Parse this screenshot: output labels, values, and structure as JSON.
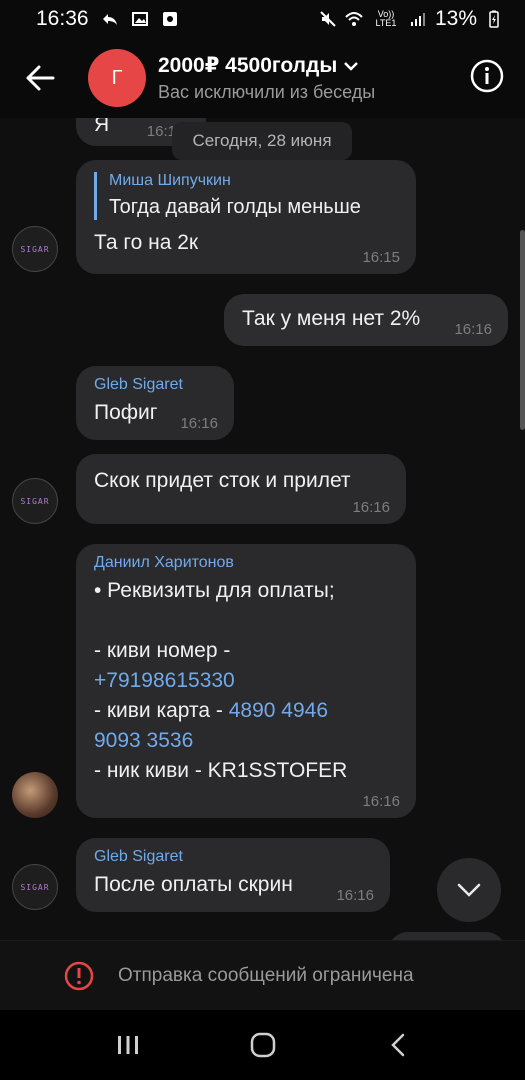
{
  "status": {
    "time": "16:36",
    "lte": "Vo)) LTE1",
    "battery": "13%"
  },
  "header": {
    "avatar_letter": "Г",
    "title": "2000₽ 4500голды",
    "subtitle": "Вас исключили из беседы"
  },
  "chat": {
    "date_chip": "Сегодня, 28 июня",
    "partial_top": {
      "text": "Я",
      "time": "16:1"
    },
    "messages": [
      {
        "reply_author": "Миша Шипучкин",
        "reply_text": "Тогда давай голды меньше",
        "text": "Та го на 2к",
        "time": "16:15"
      },
      {
        "text": "Так у меня нет 2%",
        "time": "16:16"
      },
      {
        "sender": "Gleb Sigaret",
        "text": "Пофиг",
        "time": "16:16"
      },
      {
        "text": "Скок придет сток и прилет",
        "time": "16:16"
      },
      {
        "sender": "Даниил Харитонов",
        "lines": [
          "• Реквизиты для оплаты;",
          "",
          "- киви номер -"
        ],
        "phone": "+79198615330",
        "card_prefix": "- киви карта - ",
        "card_part1": "4890 4946",
        "card_part2": "9093 3536",
        "nick_line": "- ник киви - KR1SSTOFER",
        "time": "16:16"
      },
      {
        "sender": "Gleb Sigaret",
        "text": "После оплаты скрин",
        "time": "16:16"
      }
    ],
    "avatar_tag": "SIGAR"
  },
  "restriction": {
    "text": "Отправка сообщений ограничена"
  },
  "colors": {
    "accent": "#71aaeb",
    "avatar_red": "#e64646",
    "warning_red": "#e64646"
  }
}
